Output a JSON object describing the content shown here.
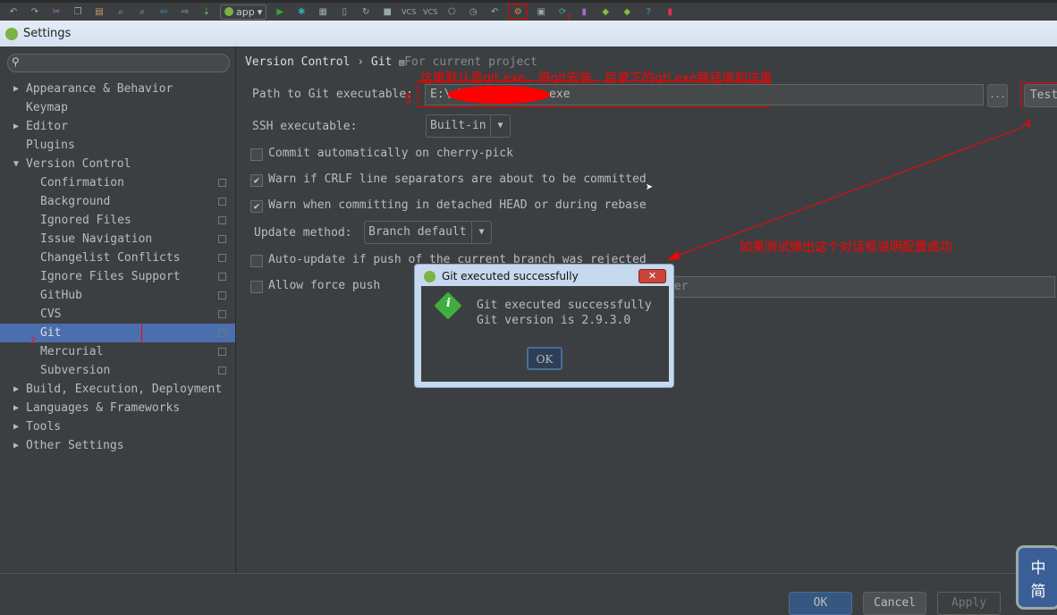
{
  "toolbar": {
    "run_config": "app",
    "annotation_1": "1",
    "vcs1": "VCS",
    "vcs2": "VCS"
  },
  "window": {
    "title": "Settings"
  },
  "sidebar": {
    "items": [
      {
        "label": "Appearance & Behavior",
        "arrow": "▶"
      },
      {
        "label": "Keymap"
      },
      {
        "label": "Editor",
        "arrow": "▶"
      },
      {
        "label": "Plugins"
      },
      {
        "label": "Version Control",
        "arrow": "▼"
      },
      {
        "label": "Confirmation",
        "child": true
      },
      {
        "label": "Background",
        "child": true
      },
      {
        "label": "Ignored Files",
        "child": true
      },
      {
        "label": "Issue Navigation",
        "child": true
      },
      {
        "label": "Changelist Conflicts",
        "child": true
      },
      {
        "label": "Ignore Files Support",
        "child": true
      },
      {
        "label": "GitHub",
        "child": true
      },
      {
        "label": "CVS",
        "child": true
      },
      {
        "label": "Git",
        "child": true,
        "selected": true
      },
      {
        "label": "Mercurial",
        "child": true
      },
      {
        "label": "Subversion",
        "child": true
      },
      {
        "label": "Build, Execution, Deployment",
        "arrow": "▶"
      },
      {
        "label": "Languages & Frameworks",
        "arrow": "▶"
      },
      {
        "label": "Tools",
        "arrow": "▶"
      },
      {
        "label": "Other Settings",
        "arrow": "▶"
      }
    ],
    "annotation_2": "2"
  },
  "main": {
    "breadcrumb": {
      "parent": "Version Control",
      "sep": "›",
      "current": "Git",
      "scope": "For current project"
    },
    "path_label": "Path to Git executable:",
    "path_value": "E:\\          \\Git\\bin\\git.exe",
    "browse_label": "...",
    "test_label": "Test",
    "ssh_label": "SSH executable:",
    "ssh_value": "Built-in",
    "options": [
      {
        "label": "Commit automatically on cherry-pick",
        "checked": false
      },
      {
        "label": "Warn if CRLF line separators are about to be committed",
        "checked": true
      },
      {
        "label": "Warn when committing in detached HEAD or during rebase",
        "checked": true
      }
    ],
    "update_label": "Update method:",
    "update_value": "Branch default",
    "options2": [
      {
        "label": "Auto-update if push of the current branch was rejected",
        "checked": false
      },
      {
        "label": "Allow force push",
        "checked": false
      }
    ],
    "protected_value": "ter"
  },
  "annotations": {
    "path_note": "这里默认是git.exe，将git安装，目录下的gti.exe路径填到这里",
    "num3": "3",
    "num4": "4",
    "success_note": "如果测试弹出这个对话框说明配置成功"
  },
  "dialog": {
    "title": "Git executed successfully",
    "line1": "Git executed successfully",
    "line2": "Git version is 2.9.3.0",
    "ok": "OK",
    "close": "✕"
  },
  "footer": {
    "ok": "OK",
    "cancel": "Cancel",
    "apply": "Apply"
  },
  "ime": {
    "c1": "中",
    "c2": "简"
  },
  "colors": {
    "accent": "#4b6eaf",
    "background": "#3c3f41",
    "annotation": "#ff0000"
  }
}
